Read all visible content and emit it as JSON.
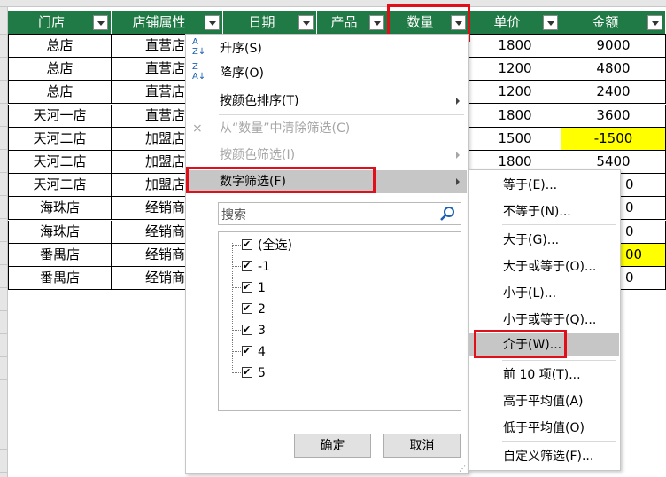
{
  "headers": [
    {
      "label": "门店"
    },
    {
      "label": "店铺属性"
    },
    {
      "label": "日期"
    },
    {
      "label": "产品"
    },
    {
      "label": "数量"
    },
    {
      "label": "单价"
    },
    {
      "label": "金额"
    }
  ],
  "rows": [
    {
      "store": "总店",
      "attr": "直营店",
      "price": "1800",
      "amount": "9000"
    },
    {
      "store": "总店",
      "attr": "直营店",
      "price": "1200",
      "amount": "4800"
    },
    {
      "store": "总店",
      "attr": "直营店（旗",
      "price": "1200",
      "amount": "2400"
    },
    {
      "store": "天河一店",
      "attr": "直营店",
      "price": "1800",
      "amount": "3600"
    },
    {
      "store": "天河二店",
      "attr": "加盟店",
      "price": "1500",
      "amount": "-1500"
    },
    {
      "store": "天河二店",
      "attr": "加盟店",
      "price": "1800",
      "amount": "5400"
    },
    {
      "store": "天河二店",
      "attr": "加盟店",
      "price": "",
      "amount": "0"
    },
    {
      "store": "海珠店",
      "attr": "经销商",
      "price": "",
      "amount": "0"
    },
    {
      "store": "海珠店",
      "attr": "经销商",
      "price": "",
      "amount": "0"
    },
    {
      "store": "番禺店",
      "attr": "经销商",
      "price": "",
      "amount": "00"
    },
    {
      "store": "番禺店",
      "attr": "经销商",
      "price": "",
      "amount": "0"
    }
  ],
  "filter_menu": {
    "sort_asc": "升序(S)",
    "sort_desc": "降序(O)",
    "sort_by_color": "按颜色排序(T)",
    "clear_filter": "从“数量”中清除筛选(C)",
    "filter_by_color": "按颜色筛选(I)",
    "number_filters": "数字筛选(F)",
    "search_placeholder": "搜索",
    "values": [
      "(全选)",
      "-1",
      "1",
      "2",
      "3",
      "4",
      "5"
    ],
    "ok": "确定",
    "cancel": "取消"
  },
  "number_filter_submenu": [
    "等于(E)...",
    "不等于(N)...",
    "大于(G)...",
    "大于或等于(O)...",
    "小于(L)...",
    "小于或等于(Q)...",
    "介于(W)...",
    "前 10 项(T)...",
    "高于平均值(A)",
    "低于平均值(O)",
    "自定义筛选(F)..."
  ],
  "colors": {
    "header_bg": "#1f7a45",
    "highlight_red": "#e0101a",
    "yellow_fill": "#ffff00",
    "menu_hover": "#c6c6c6"
  }
}
